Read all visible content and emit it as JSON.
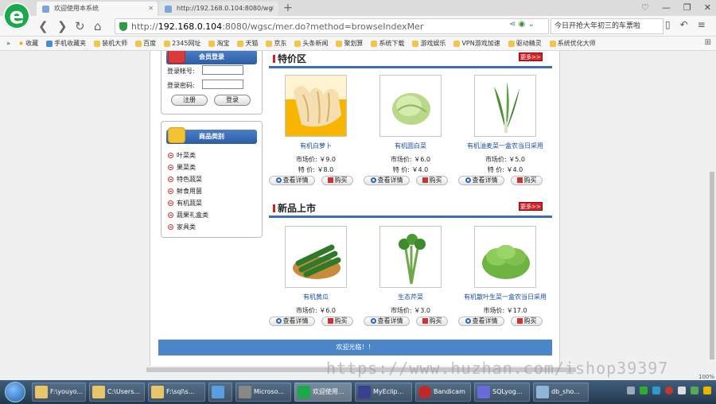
{
  "browser": {
    "logo_glyph": "e",
    "tabs": [
      {
        "label": "欢迎使用本系统"
      },
      {
        "label": "http://192.168.0.104:8080/wg"
      }
    ],
    "new_tab_glyph": "+",
    "window_buttons": [
      "♡",
      "—",
      "❐",
      "✕"
    ],
    "nav": {
      "back": "❮",
      "forward": "❯",
      "reload": "↻",
      "home": "⌂"
    },
    "address": {
      "protocol": "http://",
      "host": "192.168.0.104",
      "rest": ":8080/wgsc/mer.do?method=browseIndexMer"
    },
    "search_text": "今日开抢大年初三的车票啦",
    "right_icons": [
      "▯",
      "↶",
      "≡"
    ],
    "bookmarks": [
      {
        "label": "收藏",
        "icon": "star-icon"
      },
      {
        "label": "手机收藏夹",
        "icon": "phone-icon"
      },
      {
        "label": "装机大师",
        "icon": "folder-icon"
      },
      {
        "label": "百度",
        "icon": "folder-icon"
      },
      {
        "label": "2345网址",
        "icon": "folder-icon"
      },
      {
        "label": "淘宝",
        "icon": "folder-icon"
      },
      {
        "label": "天猫",
        "icon": "folder-icon"
      },
      {
        "label": "京东",
        "icon": "folder-icon"
      },
      {
        "label": "头条新闻",
        "icon": "folder-icon"
      },
      {
        "label": "聚划算",
        "icon": "folder-icon"
      },
      {
        "label": "系统下载",
        "icon": "folder-icon"
      },
      {
        "label": "游戏娱乐",
        "icon": "folder-icon"
      },
      {
        "label": "VPN游戏加速",
        "icon": "folder-icon"
      },
      {
        "label": "驱动精灵",
        "icon": "folder-icon"
      },
      {
        "label": "系统优化大师",
        "icon": "folder-icon"
      }
    ]
  },
  "login": {
    "title": "会员登录",
    "account_label": "登录帐号:",
    "password_label": "登录密码:",
    "register_button": "注册",
    "login_button": "登录"
  },
  "categories": {
    "title": "商品类别",
    "items": [
      "叶菜类",
      "果菜类",
      "特色蔬菜",
      "鲜食用菌",
      "有机蔬菜",
      "蔬果礼盒类",
      "家具类"
    ]
  },
  "special": {
    "title": "特价区",
    "more": "更多>>",
    "products": [
      {
        "name": "有机白萝卜",
        "market_label": "市场价:",
        "market_price": "￥9.0",
        "special_label": "特 价:",
        "special_price": "￥8.0"
      },
      {
        "name": "有机圆白菜",
        "market_label": "市场价:",
        "market_price": "￥6.0",
        "special_label": "特 价:",
        "special_price": "￥4.0"
      },
      {
        "name": "有机油麦菜一盒农当日采用",
        "market_label": "市场价:",
        "market_price": "￥5.0",
        "special_label": "特 价:",
        "special_price": "￥4.0"
      }
    ],
    "detail_button": "查看详情",
    "buy_button": "购买"
  },
  "new_arrivals": {
    "title": "新品上市",
    "more": "更多>>",
    "products": [
      {
        "name": "有机黄瓜",
        "market_label": "市场价:",
        "market_price": "￥6.0"
      },
      {
        "name": "生态芹菜",
        "market_label": "市场价:",
        "market_price": "￥3.0"
      },
      {
        "name": "有机散叶生菜一盒农当日采用",
        "market_label": "市场价:",
        "market_price": "￥17.0"
      }
    ],
    "detail_button": "查看详情",
    "buy_button": "购买"
  },
  "footer": {
    "text": "欢迎光临！！"
  },
  "watermark": "https://www.huzhan.com/ishop39397",
  "zoom": "100%",
  "taskbar": {
    "items": [
      {
        "label": "F:\\youyo...",
        "color": "#e9c46a"
      },
      {
        "label": "C:\\Users...",
        "color": "#e9c46a"
      },
      {
        "label": "F:\\sql\\s...",
        "color": "#e9c46a"
      },
      {
        "label": "",
        "color": "#5a9de0"
      },
      {
        "label": "Microso...",
        "color": "#888888"
      },
      {
        "label": "欢迎使用...",
        "color": "#19a84b"
      },
      {
        "label": "MyEclip...",
        "color": "#3a3f8f"
      },
      {
        "label": "Bandicam",
        "color": "#c0282a"
      },
      {
        "label": "SQLyog...",
        "color": "#6a6ad8"
      },
      {
        "label": "db_sho...",
        "color": "#8fb5d8"
      }
    ]
  },
  "colors": {
    "accent": "#3a6fb5",
    "header_blue": "#2c5ea8",
    "more_red": "#d0282a",
    "footer_blue": "#4a86c8",
    "link_blue": "#1d4ea3"
  }
}
